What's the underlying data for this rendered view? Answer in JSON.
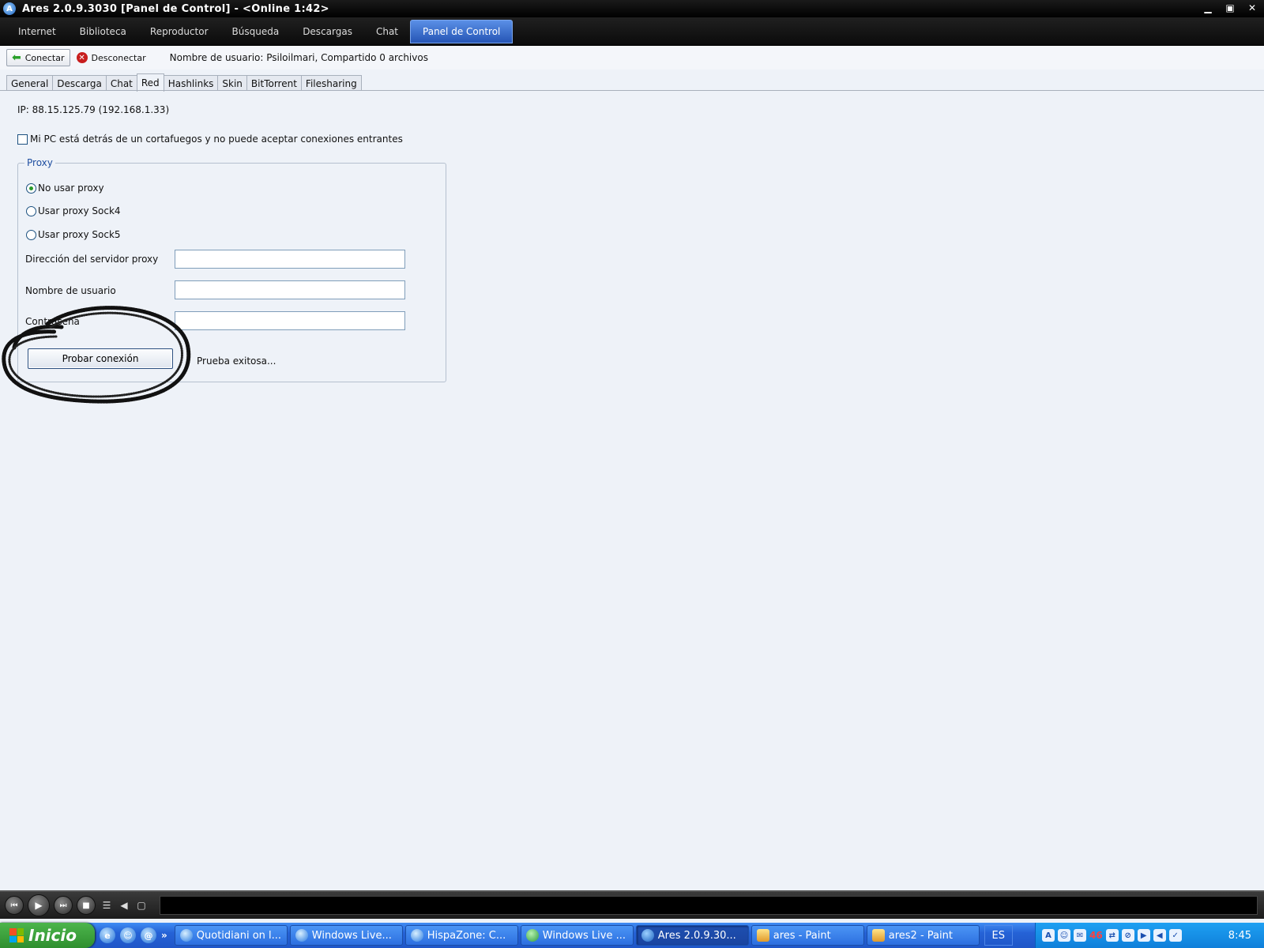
{
  "window": {
    "title": "Ares 2.0.9.3030   [Panel de Control]  -  <Online 1:42>",
    "app_icon": "ares-icon",
    "controls": [
      "minimize-icon",
      "maximize-icon",
      "close-icon"
    ]
  },
  "main_menu": {
    "items": [
      {
        "label": "Internet"
      },
      {
        "label": "Biblioteca"
      },
      {
        "label": "Reproductor"
      },
      {
        "label": "Búsqueda"
      },
      {
        "label": "Descargas"
      },
      {
        "label": "Chat"
      },
      {
        "label": "Panel de Control",
        "active": true
      }
    ]
  },
  "connection": {
    "connect_label": "Conectar",
    "disconnect_label": "Desconectar",
    "status": "Nombre de usuario: Psiloilmari, Compartido 0 archivos"
  },
  "settings_tabs": {
    "items": [
      {
        "label": "General"
      },
      {
        "label": "Descarga"
      },
      {
        "label": "Chat"
      },
      {
        "label": "Red",
        "active": true
      },
      {
        "label": "Hashlinks"
      },
      {
        "label": "Skin"
      },
      {
        "label": "BitTorrent"
      },
      {
        "label": "Filesharing"
      }
    ]
  },
  "network": {
    "ip_text": "IP: 88.15.125.79 (192.168.1.33)",
    "firewall_label": "Mi PC está detrás de un cortafuegos y no puede aceptar conexiones entrantes",
    "firewall_checked": false
  },
  "proxy": {
    "legend": "Proxy",
    "options": [
      {
        "label": "No usar proxy",
        "selected": true
      },
      {
        "label": "Usar proxy Sock4",
        "selected": false
      },
      {
        "label": "Usar proxy Sock5",
        "selected": false
      }
    ],
    "server_label": "Dirección del servidor proxy",
    "server_value": "",
    "username_label": "Nombre de usuario",
    "username_value": "",
    "password_label": "Contraseña",
    "password_value": "",
    "test_button": "Probar conexión",
    "test_result": "Prueba exitosa..."
  },
  "player": {
    "buttons": [
      "previous-icon",
      "play-icon",
      "next-icon",
      "stop-icon",
      "playlist-icon",
      "volume-icon",
      "window-icon"
    ]
  },
  "taskbar": {
    "start_label": "Inicio",
    "more": "»",
    "tasks": [
      {
        "label": "Quotidiani on l...",
        "icon": "ie-icon"
      },
      {
        "label": "Windows Live...",
        "icon": "ie-icon"
      },
      {
        "label": "HispaZone: C...",
        "icon": "ie-icon"
      },
      {
        "label": "Windows Live ...",
        "icon": "msn-icon"
      },
      {
        "label": "Ares 2.0.9.30...",
        "icon": "ares-icon",
        "active": true
      },
      {
        "label": "ares - Paint",
        "icon": "paint-icon"
      },
      {
        "label": "ares2 - Paint",
        "icon": "paint-icon"
      }
    ],
    "language": "ES",
    "tray_badge": "46",
    "clock": "8:45"
  },
  "colors": {
    "menu_active": "#2e63c4",
    "content_bg": "#eef2f8",
    "radio_dot": "#2a9a2a",
    "taskbar": "#2562d6",
    "start_button": "#3a9e3a"
  }
}
